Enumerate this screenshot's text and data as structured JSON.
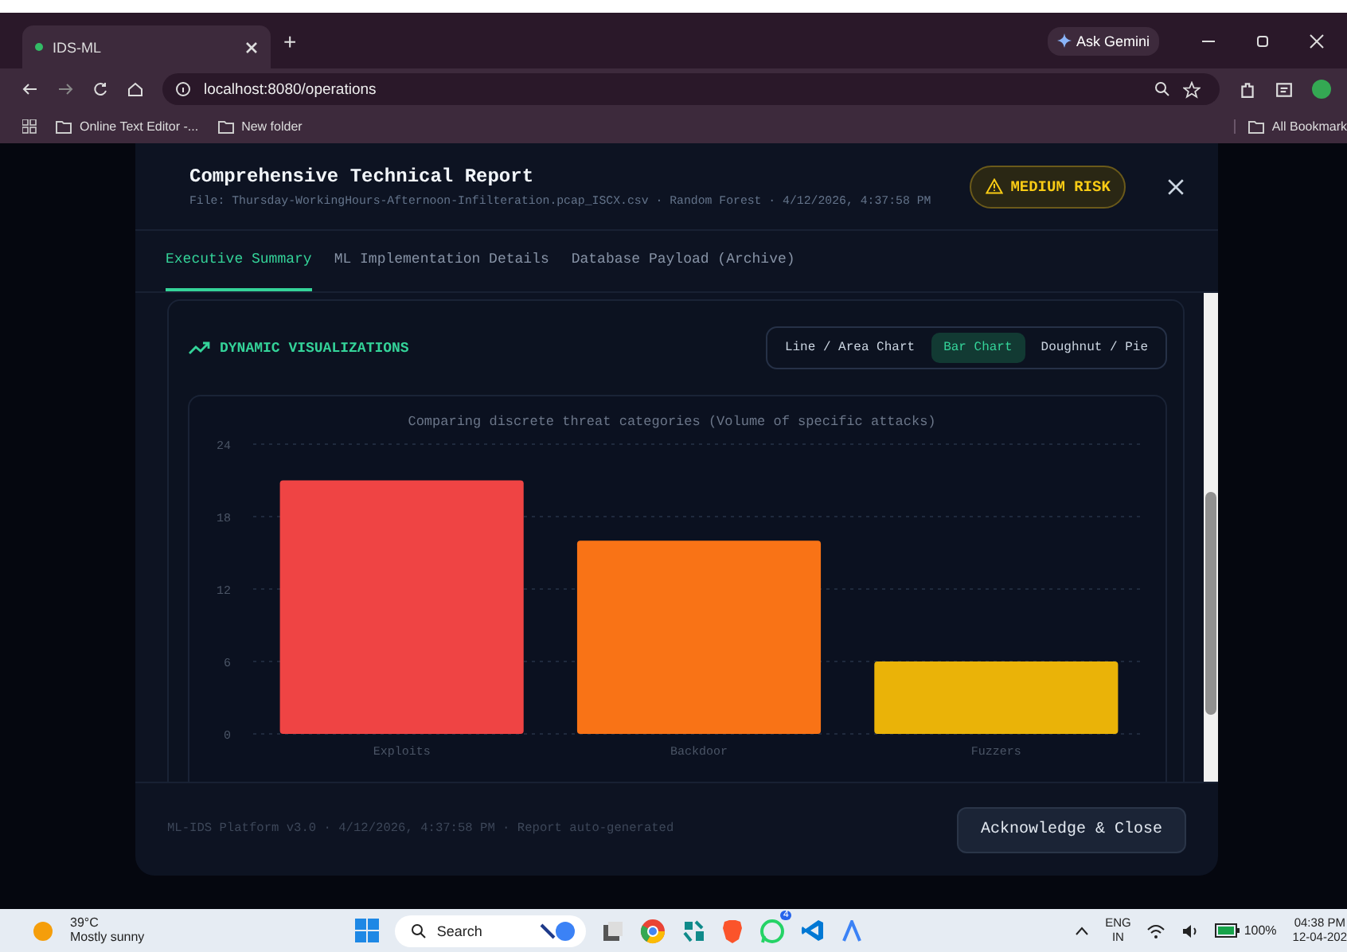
{
  "browser": {
    "tabs": [
      {
        "title": "IDS-ML",
        "selected": true
      }
    ],
    "new_tab": "+",
    "ask_gemini": "Ask Gemini",
    "address": "localhost:8080/operations",
    "bookmarks": [
      "Online Text Editor -...",
      "New folder"
    ],
    "all_bookmarks": "All Bookmark"
  },
  "modal": {
    "title": "Comprehensive Technical Report",
    "subtitle": "File: Thursday-WorkingHours-Afternoon-Infilteration.pcap_ISCX.csv · Random Forest · 4/12/2026, 4:37:58 PM",
    "risk": "MEDIUM RISK",
    "tabs": [
      {
        "label": "Executive Summary",
        "selected": true
      },
      {
        "label": "ML Implementation Details",
        "selected": false
      },
      {
        "label": "Database Payload (Archive)",
        "selected": false
      }
    ],
    "section_title": "DYNAMIC VISUALIZATIONS",
    "chart_types": [
      {
        "label": "Line / Area Chart",
        "selected": false
      },
      {
        "label": "Bar Chart",
        "selected": true
      },
      {
        "label": "Doughnut / Pie",
        "selected": false
      }
    ],
    "chart_data": {
      "type": "bar",
      "title": "Comparing discrete threat categories (Volume of specific attacks)",
      "categories": [
        "Exploits",
        "Backdoor",
        "Fuzzers"
      ],
      "values": [
        21,
        16,
        6
      ],
      "colors": [
        "#ef4444",
        "#f97316",
        "#eab308"
      ],
      "ylim": [
        0,
        24
      ],
      "grid": true,
      "yticks": [
        0,
        6,
        12,
        18,
        24
      ]
    },
    "footer": "ML-IDS Platform v3.0 · 4/12/2026, 4:37:58 PM · Report auto-generated",
    "button": "Acknowledge & Close"
  },
  "taskbar": {
    "temperature": "39°C",
    "weather": "Mostly sunny",
    "search": "Search",
    "whatsapp_badge": "4",
    "language": "ENG",
    "region": "IN",
    "battery": "100%",
    "time": "04:38 PM",
    "date": "12-04-202"
  }
}
